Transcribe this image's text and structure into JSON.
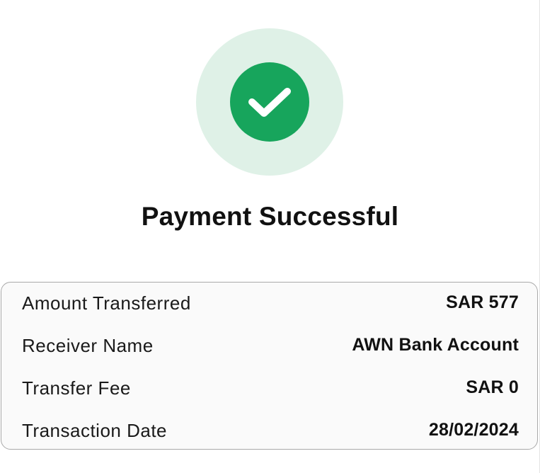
{
  "status": {
    "icon": "check-icon",
    "title": "Payment Successful",
    "colors": {
      "success": "#17a55c",
      "halo": "#dff1e7"
    }
  },
  "details": {
    "rows": [
      {
        "label": "Amount Transferred",
        "value": "SAR 577"
      },
      {
        "label": "Receiver Name",
        "value": "AWN Bank Account"
      },
      {
        "label": "Transfer Fee",
        "value": "SAR 0"
      },
      {
        "label": "Transaction Date",
        "value": "28/02/2024"
      }
    ]
  }
}
